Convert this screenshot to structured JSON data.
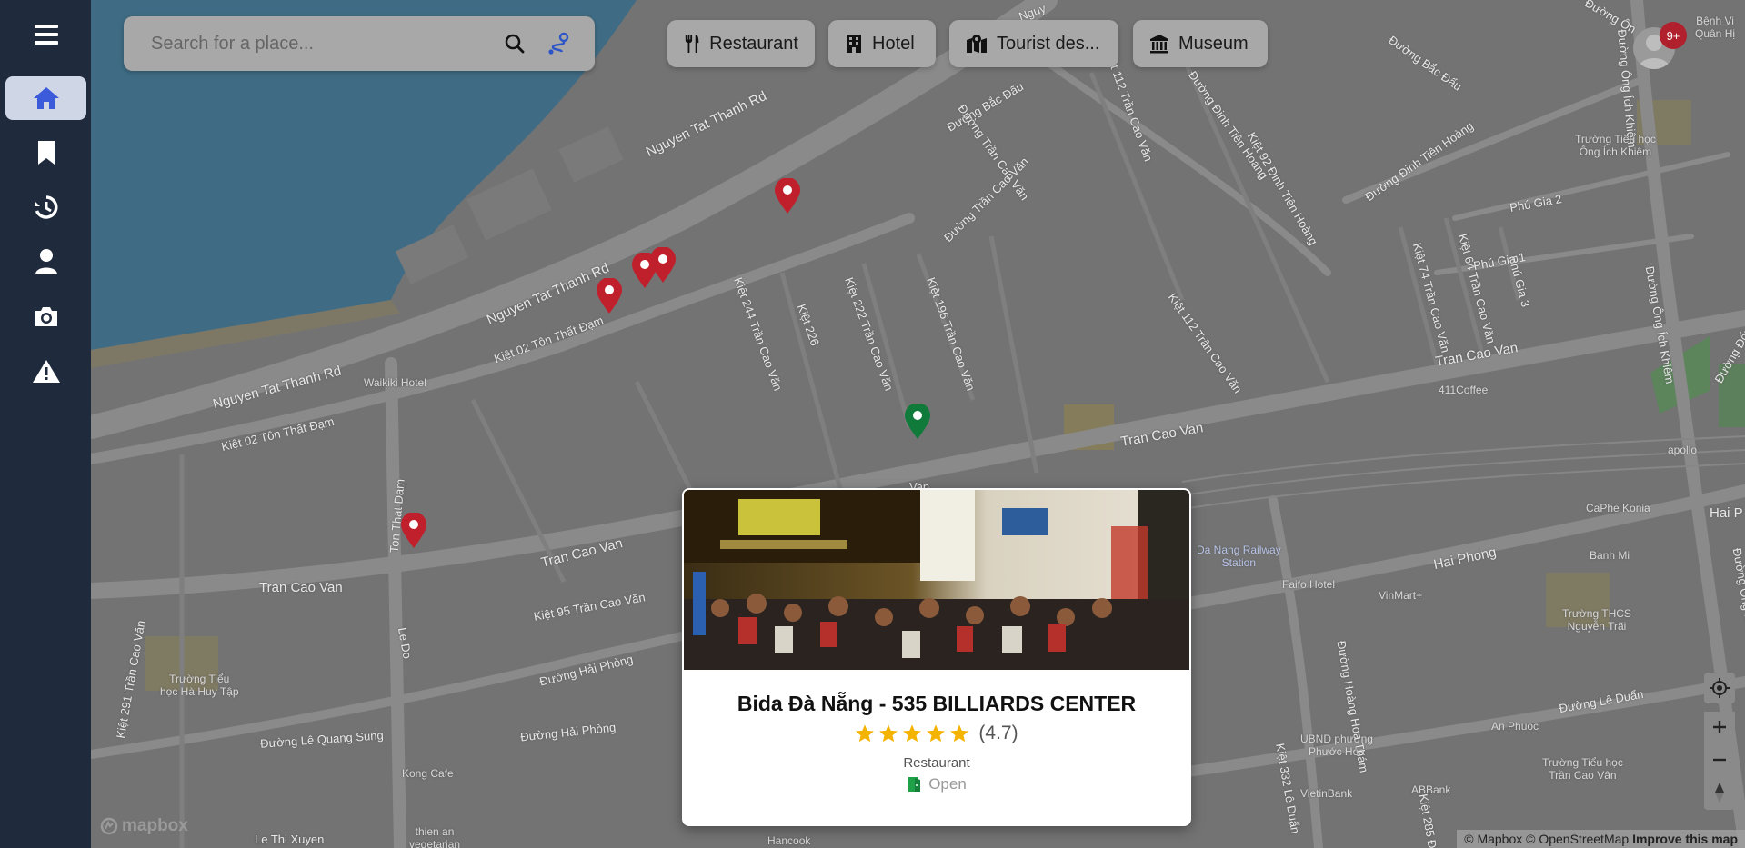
{
  "sidebar": {
    "items": [
      {
        "icon": "menu-icon"
      },
      {
        "icon": "home-icon",
        "active": true
      },
      {
        "icon": "bookmark-icon"
      },
      {
        "icon": "history-icon"
      },
      {
        "icon": "user-icon"
      },
      {
        "icon": "camera-icon"
      },
      {
        "icon": "warning-icon"
      }
    ]
  },
  "search": {
    "placeholder": "Search for a place...",
    "search_icon": "search-icon",
    "directions_icon": "route-icon"
  },
  "categories": [
    {
      "label": "Restaurant",
      "icon": "utensils-icon"
    },
    {
      "label": "Hotel",
      "icon": "building-icon"
    },
    {
      "label": "Tourist des...",
      "icon": "map-location-icon"
    },
    {
      "label": "Museum",
      "icon": "landmark-icon"
    }
  ],
  "notifications": {
    "badge": "9+"
  },
  "map_labels": {
    "nguyen_tat_thanh_1": "Nguyen Tat Thanh Rd",
    "nguyen_tat_thanh_2": "Nguyen Tat Thanh Rd",
    "nguyen_tat_thanh_3": "Nguyen Tat Thanh Rd",
    "kiet_02_ton_that_dam_1": "Kiệt 02 Tôn Thất Đạm",
    "kiet_02_ton_that_dam_2": "Kiệt 02 Tôn Thất Đạm",
    "waikiki_hotel": "Waikiki Hotel",
    "ton_that_dam": "Ton That Dam",
    "tran_cao_van_1": "Tran Cao Van",
    "tran_cao_van_2": "Tran Cao Van",
    "tran_cao_van_3": "Tran Cao Van",
    "tran_cao_van_4": "Tran Cao Van",
    "le_do": "Le Do",
    "kiet_244": "Kiệt 244 Trần Cao Văn",
    "kiet_226": "Kiệt 226",
    "kiet_222": "Kiệt 222 Trần Cao Văn",
    "kiet_196": "Kiệt 196 Trần Cao Văn",
    "kiet_95": "Kiệt 95 Trần Cao Văn",
    "duong_hai_phong_1": "Đường Hải Phòng",
    "duong_hai_phong_2": "Đường Hải Phòng",
    "duong_le_quang_sung": "Đường Lê Quang Sung",
    "le_thi_xuyen": "Le Thi Xuyen",
    "kong_cafe": "Kong Cafe",
    "truong_tieu_hoc_ha_huy_tap": "Trường Tiểu\nhọc Hà Huy Tập",
    "kiet_291": "Kiệt 291 Trần Cao Văn",
    "thien_an": "thien an\nvegetarian",
    "hancook": "Hancook",
    "duong_bac_dau_1": "Đường Bắc Đẩu",
    "duong_bac_dau_2": "Đường Bắc Đẩu",
    "duong_tran_cao_van_1": "Đường Trần Cao Văn",
    "duong_tran_cao_van_2": "Đường Trần Cao Văn",
    "kiet_112_a": "Kiệt 112 Trần Cao Văn",
    "kiet_112_b": "Kiệt 112 Trần Cao Văn",
    "kiet_92": "Kiệt 92 Đinh Tiên Hoàng",
    "duong_dinh_tien_hoang_1": "Đường Đinh Tiên Hoàng",
    "duong_dinh_tien_hoang_2": "Đường Đinh Tiên Hoàng",
    "kiet_74": "Kiệt 74 Trần Cao Văn",
    "kiet_64": "Kiệt 64 Trần Cao Văn",
    "phu_gia_3": "Phú Gia 3",
    "phu_gia_2": "Phú Gia 2",
    "phu_gia_1": "Phú Gia 1",
    "duong_ong_ich_khiem_1": "Đường Ông Ích Khiêm",
    "duong_ong_ich_khiem_2": "Đường Ông Ích Khiêm",
    "duong_ong_ich_khiem_3": "Đường Ông Ích Khiêm",
    "truong_tieu_hoc_ong_ich_khiem": "Trường Tiểu học\nÔng Ích Khiêm",
    "coffee_411": "411Coffee",
    "apollo": "apollo",
    "caphe_konia": "CaPhe Konia",
    "banh_mi": "Banh Mi",
    "da_nang_railway": "Da Nang Railway\nStation",
    "faifo_hotel": "Faifo Hotel",
    "vinmart": "VinMart+",
    "hai_phong": "Hai Phong",
    "hai_p": "Hai P",
    "truong_thcs_nguyen_trai": "Trường THCS\nNguyễn Trãi",
    "duong_le_duan": "Đường Lê Duẩn",
    "an_phuoc": "An Phuoc",
    "truong_tieu_hoc_tran_cao_van": "Trường Tiểu học\nTrần Cao Vân",
    "ubnd_phuoc_hoa": "UBND phường\nPhước Hòa",
    "vietinbank": "VietinBank",
    "abbank": "ABBank",
    "duong_hoang_hoa_tham": "Đường Hoàng Hoa Thám",
    "kiet_332": "Kiệt 332 Lê Duẩn",
    "kiet_285": "Kiệt 285 Đ",
    "benh_vien": "Bệnh Vi\nQuân Hị",
    "duong_ong": "Đường Ôn",
    "van": "Van",
    "duong_dong": "Đường Đống",
    "ngu": "Nguy"
  },
  "card": {
    "title": "Bida Đà Nẵng - 535 BILLIARDS CENTER",
    "rating_stars": 5,
    "rating": "(4.7)",
    "type": "Restaurant",
    "status": "Open",
    "colors": {
      "star": "#f5b301",
      "status_icon": "#1fa14a"
    }
  },
  "attribution": {
    "mapbox": "© Mapbox",
    "osm": "© OpenStreetMap",
    "improve": "Improve this map"
  },
  "mapbox_logo": "mapbox",
  "colors": {
    "sidebar": "#1f2a3c",
    "active_icon": "#3b5bdb",
    "pin_red": "#c0202b",
    "pin_green": "#0f7a3a",
    "water": "#3f6c84"
  }
}
